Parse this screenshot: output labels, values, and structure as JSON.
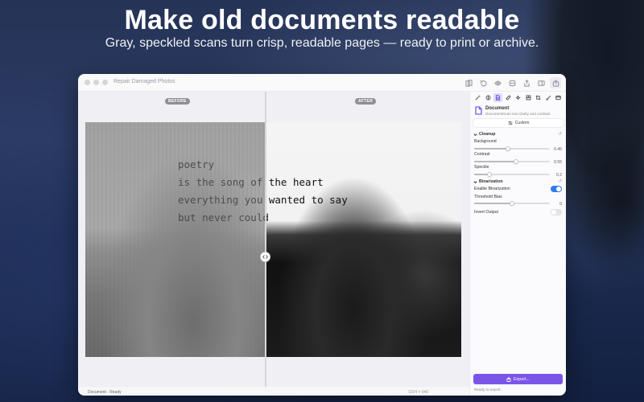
{
  "hero": {
    "title": "Make old documents readable",
    "subtitle": "Gray, speckled scans turn crisp, readable pages — ready to print or archive."
  },
  "window": {
    "title": "Repair Damaged Photos",
    "toolbar_icons": [
      "compare-icon",
      "undo-icon",
      "eye-icon",
      "mask-icon",
      "share-icon",
      "sidebar-icon",
      "export-icon"
    ]
  },
  "canvas": {
    "before_label": "BEFORE",
    "after_label": "AFTER",
    "poem_lines": [
      "poetry",
      "is the song of the heart",
      "everything you wanted to say",
      "but never could"
    ]
  },
  "status": {
    "left": "Document · Ready",
    "right": "1024 × 640"
  },
  "panel": {
    "tools": [
      "magic-wand-icon",
      "adjust-icon",
      "document-icon",
      "bandage-icon",
      "settings-icon",
      "halftone-icon",
      "crop-icon",
      "brush-icon",
      "film-icon",
      "save-icon"
    ],
    "active_tool_index": 2,
    "preset": {
      "title": "Document",
      "description": "Document/scan text clarity and contrast"
    },
    "segment_label": "Custom",
    "cleanup": {
      "title": "Cleanup",
      "params": [
        {
          "label": "Background",
          "value": "0.45",
          "fraction": 0.45
        },
        {
          "label": "Contrast",
          "value": "0.55",
          "fraction": 0.55
        },
        {
          "label": "Speckle",
          "value": "0.2",
          "fraction": 0.2
        }
      ]
    },
    "binarization": {
      "title": "Binarization",
      "enable_label": "Enable Binarization",
      "enabled": true,
      "threshold_label": "Threshold Bias",
      "threshold_value": "0",
      "threshold_fraction": 0.5,
      "invert_label": "Invert Output",
      "invert": false
    },
    "export_label": "Export...",
    "export_status": "Ready to export."
  },
  "colors": {
    "accent": "#7b55e8",
    "toggle_on": "#2f7cf6"
  }
}
